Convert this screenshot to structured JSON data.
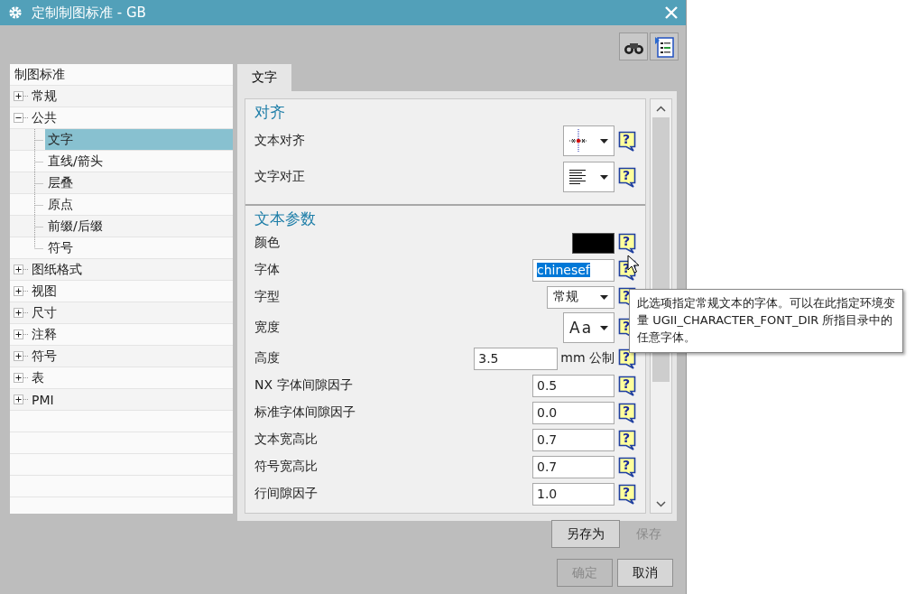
{
  "window": {
    "title": "定制制图标准 - GB"
  },
  "tree": {
    "header": "制图标准",
    "items": [
      {
        "label": "常规",
        "expanded": false,
        "selected": false
      },
      {
        "label": "公共",
        "expanded": true,
        "selected": false,
        "children": [
          {
            "label": "文字",
            "selected": true
          },
          {
            "label": "直线/箭头",
            "selected": false
          },
          {
            "label": "层叠",
            "selected": false
          },
          {
            "label": "原点",
            "selected": false
          },
          {
            "label": "前缀/后缀",
            "selected": false
          },
          {
            "label": "符号",
            "selected": false
          }
        ]
      },
      {
        "label": "图纸格式",
        "expanded": false,
        "selected": false
      },
      {
        "label": "视图",
        "expanded": false,
        "selected": false
      },
      {
        "label": "尺寸",
        "expanded": false,
        "selected": false
      },
      {
        "label": "注释",
        "expanded": false,
        "selected": false
      },
      {
        "label": "符号",
        "expanded": false,
        "selected": false
      },
      {
        "label": "表",
        "expanded": false,
        "selected": false
      },
      {
        "label": "PMI",
        "expanded": false,
        "selected": false
      }
    ]
  },
  "tabs": [
    {
      "label": "文字",
      "selected": true
    }
  ],
  "sections": [
    {
      "title": "对齐",
      "rows": [
        {
          "kind": "align-picker",
          "label": "文本对齐",
          "help": "?"
        },
        {
          "kind": "justify-picker",
          "label": "文字对正",
          "help": "?"
        }
      ]
    },
    {
      "title": "文本参数",
      "rows": [
        {
          "kind": "color",
          "label": "颜色",
          "color": "#000000",
          "help": "?"
        },
        {
          "kind": "field",
          "label": "字体",
          "value": "chinesef",
          "highlighted": true,
          "help": "?"
        },
        {
          "kind": "dropdown",
          "label": "字型",
          "value": "常规",
          "help": "?"
        },
        {
          "kind": "big-dropdown",
          "label": "宽度",
          "value": "Aa",
          "help": "?"
        },
        {
          "kind": "unit-field",
          "label": "高度",
          "value": "3.5",
          "unit": "mm 公制",
          "help": "?"
        },
        {
          "kind": "field",
          "label": "NX 字体间隙因子",
          "value": "0.5",
          "highlighted": false,
          "help": "?"
        },
        {
          "kind": "field",
          "label": "标准字体间隙因子",
          "value": "0.0",
          "highlighted": false,
          "help": "?"
        },
        {
          "kind": "field",
          "label": "文本宽高比",
          "value": "0.7",
          "highlighted": false,
          "help": "?"
        },
        {
          "kind": "field",
          "label": "符号宽高比",
          "value": "0.7",
          "highlighted": false,
          "help": "?"
        },
        {
          "kind": "field",
          "label": "行间隙因子",
          "value": "1.0",
          "highlighted": false,
          "help": "?"
        }
      ]
    }
  ],
  "footer": [
    [
      {
        "label": "另存为",
        "kind": "boxed",
        "disabled": false
      },
      {
        "label": "保存",
        "kind": "flat",
        "disabled": true
      }
    ],
    [
      {
        "label": "确定",
        "kind": "boxed",
        "disabled": true
      },
      {
        "label": "取消",
        "kind": "boxed",
        "disabled": false
      }
    ]
  ],
  "tooltip": {
    "text": "此选项指定常规文本的字体。可以在此指定环境变量 UGII_CHARACTER_FONT_DIR 所指目录中的任意字体。"
  }
}
